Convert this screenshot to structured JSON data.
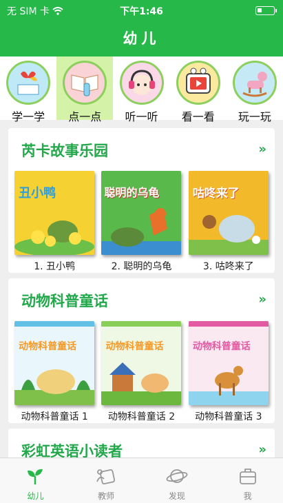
{
  "status": {
    "carrier": "无 SIM 卡",
    "time": "下午1:46"
  },
  "nav": {
    "title": "幼儿"
  },
  "categories": [
    {
      "label": "学一学",
      "icon": "butterfly-book-icon",
      "color": "#7fd0f0"
    },
    {
      "label": "点一点",
      "icon": "book-pointer-icon",
      "color": "#f7c0c8"
    },
    {
      "label": "听一听",
      "icon": "headphones-girl-icon",
      "color": "#f6b9d4"
    },
    {
      "label": "看一看",
      "icon": "tv-icon",
      "color": "#f9e37a"
    },
    {
      "label": "玩一玩",
      "icon": "rocking-horse-icon",
      "color": "#a4dbf0"
    }
  ],
  "sections": [
    {
      "title": "芮卡故事乐园",
      "more": "»",
      "books": [
        {
          "name": "1. 丑小鸭",
          "cover_title": "丑小鸭",
          "bg": "#f5d231"
        },
        {
          "name": "2. 聪明的乌龟",
          "cover_title": "聪明的乌龟",
          "bg": "#5ab94b"
        },
        {
          "name": "3. 咕咚来了",
          "cover_title": "咕咚来了",
          "bg": "#f2b92b"
        }
      ]
    },
    {
      "title": "动物科普童话",
      "more": "»",
      "books": [
        {
          "name": "动物科普童话 1",
          "cover_title": "动物科普童话",
          "bg": "#62c0e6"
        },
        {
          "name": "动物科普童话 2",
          "cover_title": "动物科普童话",
          "bg": "#88cf58"
        },
        {
          "name": "动物科普童话 3",
          "cover_title": "动物科普童话",
          "bg": "#e25aa2"
        }
      ]
    },
    {
      "title": "彩虹英语小读者",
      "more": "»"
    }
  ],
  "tabs": [
    {
      "label": "幼儿",
      "icon": "sprout-icon"
    },
    {
      "label": "教师",
      "icon": "teacher-icon"
    },
    {
      "label": "发现",
      "icon": "planet-icon"
    },
    {
      "label": "我",
      "icon": "briefcase-icon"
    }
  ],
  "colors": {
    "brand": "#26b94a",
    "active_category_bg": "#d4f3a8"
  }
}
